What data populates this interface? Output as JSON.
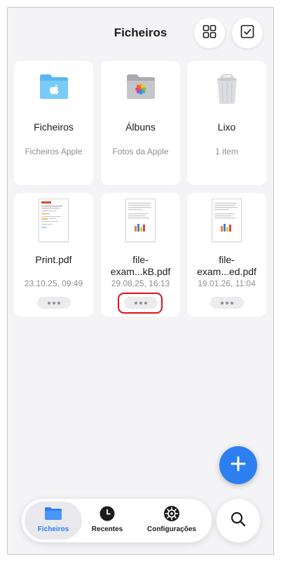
{
  "header": {
    "title": "Ficheiros"
  },
  "locations": [
    {
      "name": "Ficheiros",
      "subtitle": "Ficheiros Apple",
      "icon": "folder-apple-icon"
    },
    {
      "name": "Álbuns",
      "subtitle": "Fotos da Apple",
      "icon": "photos-folder-icon"
    },
    {
      "name": "Lixo",
      "subtitle": "1 item",
      "icon": "trash-bin-icon"
    }
  ],
  "files": [
    {
      "name": "Print.pdf",
      "date": "23.10.25, 09:49"
    },
    {
      "name": "file-exam...kB.pdf",
      "date": "29.08.25, 16:13"
    },
    {
      "name": "file-exam...ed.pdf",
      "date": "19.01.26, 11:04"
    }
  ],
  "tabs": [
    {
      "label": "Ficheiros",
      "icon": "folder-icon",
      "active": true
    },
    {
      "label": "Recentes",
      "icon": "clock-icon",
      "active": false
    },
    {
      "label": "Configurações",
      "icon": "gear-icon",
      "active": false
    }
  ],
  "colors": {
    "accent": "#2d7ff0",
    "highlight": "#e0101a",
    "background": "#f4f4f6"
  }
}
